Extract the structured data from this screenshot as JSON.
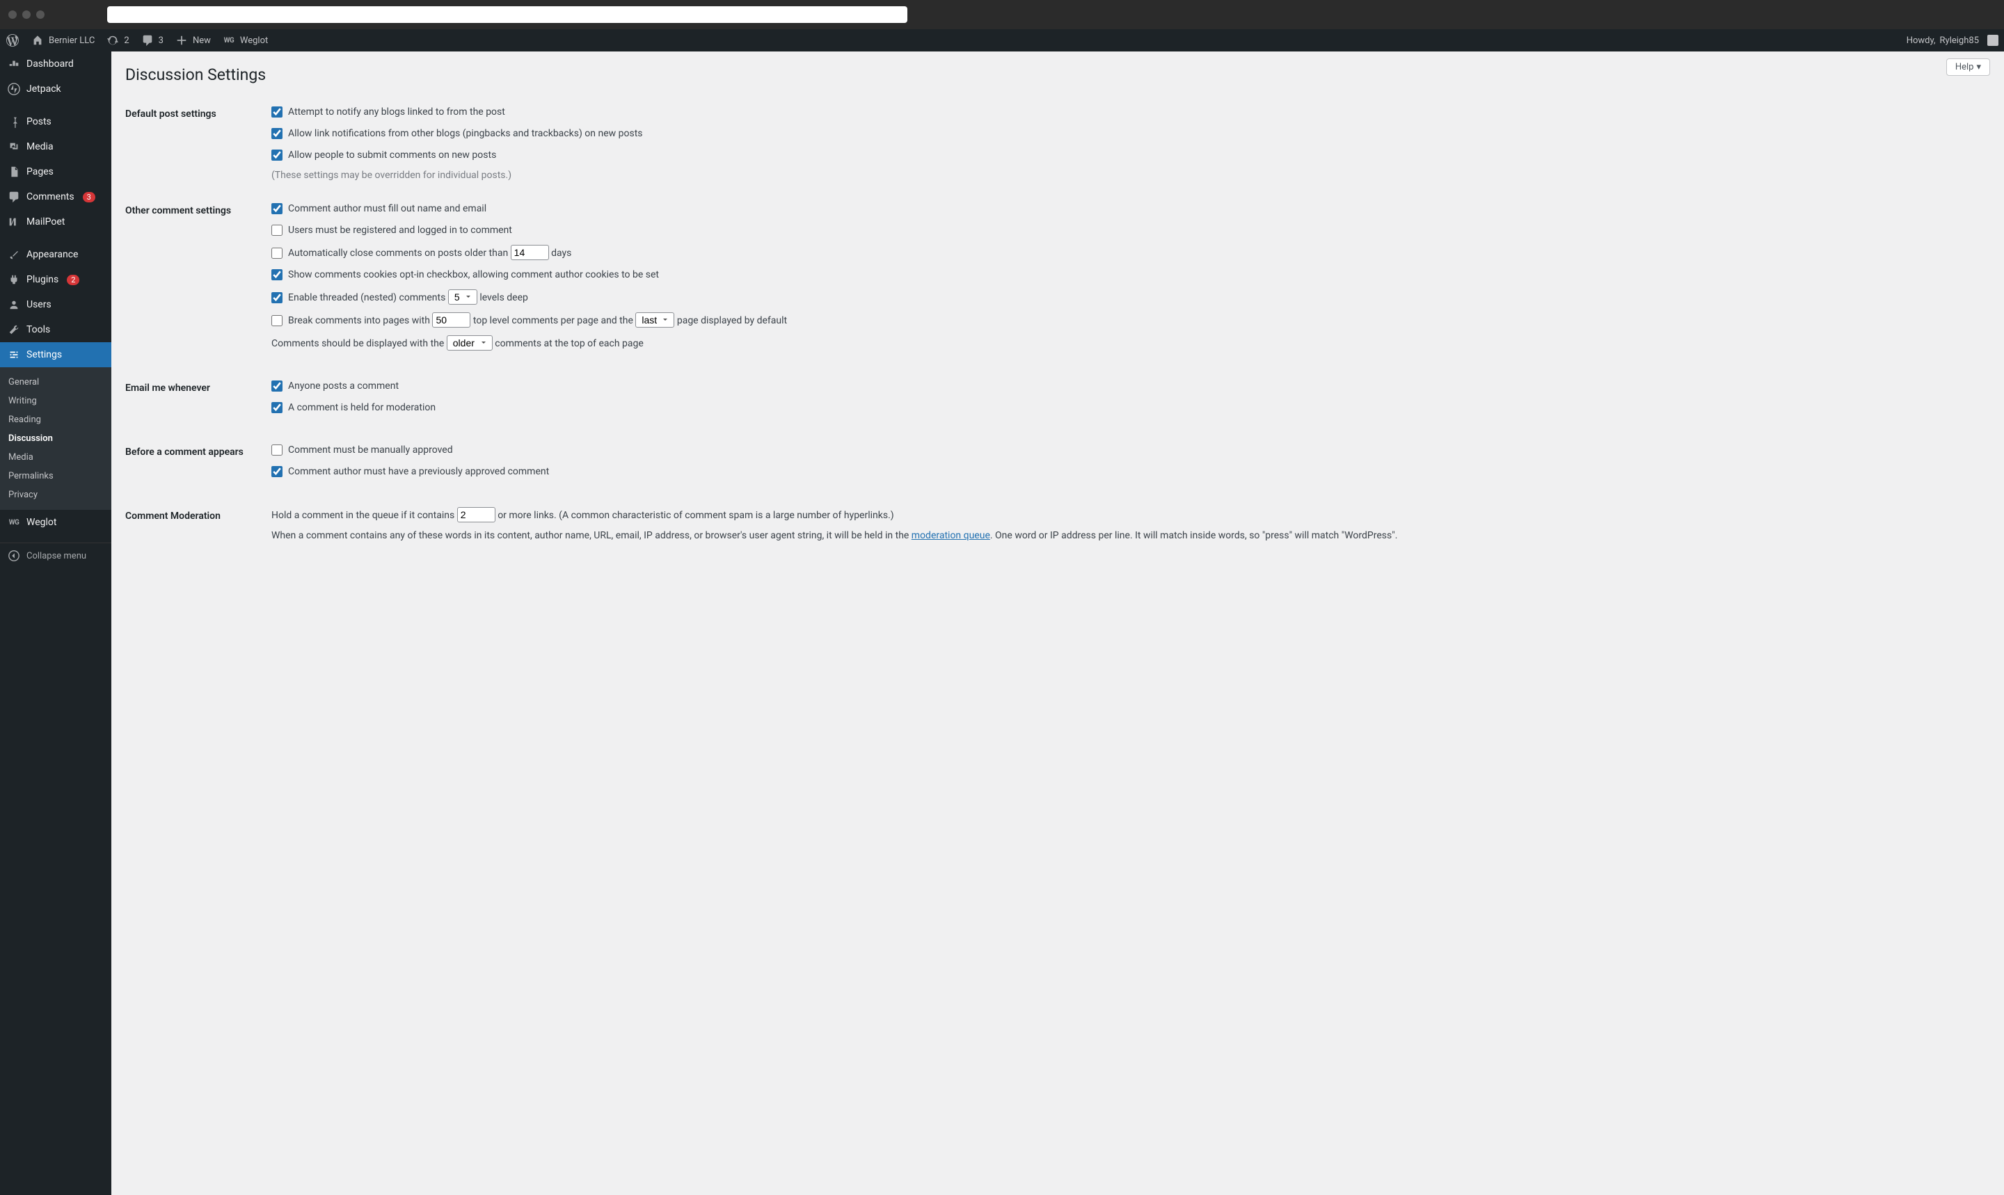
{
  "admin_bar": {
    "site_name": "Bernier LLC",
    "updates_count": "2",
    "comments_count": "3",
    "new_label": "New",
    "weglot_label": "Weglot",
    "howdy_prefix": "Howdy, ",
    "user_name": "Ryleigh85"
  },
  "sidebar": {
    "dashboard": "Dashboard",
    "jetpack": "Jetpack",
    "posts": "Posts",
    "media": "Media",
    "pages": "Pages",
    "comments": "Comments",
    "comments_badge": "3",
    "mailpoet": "MailPoet",
    "appearance": "Appearance",
    "plugins": "Plugins",
    "plugins_badge": "2",
    "users": "Users",
    "tools": "Tools",
    "settings": "Settings",
    "weglot": "Weglot",
    "collapse": "Collapse menu",
    "submenu": {
      "general": "General",
      "writing": "Writing",
      "reading": "Reading",
      "discussion": "Discussion",
      "media": "Media",
      "permalinks": "Permalinks",
      "privacy": "Privacy"
    }
  },
  "content": {
    "help_label": "Help",
    "page_title": "Discussion Settings",
    "sections": {
      "default_post": "Default post settings",
      "other_comment": "Other comment settings",
      "email_me": "Email me whenever",
      "before_appears": "Before a comment appears",
      "moderation": "Comment Moderation"
    },
    "labels": {
      "attempt_notify": "Attempt to notify any blogs linked to from the post",
      "allow_pingback": "Allow link notifications from other blogs (pingbacks and trackbacks) on new posts",
      "allow_comments": "Allow people to submit comments on new posts",
      "override_note": "(These settings may be overridden for individual posts.)",
      "require_name_email": "Comment author must fill out name and email",
      "require_registration": "Users must be registered and logged in to comment",
      "close_old_pre": "Automatically close comments on posts older than ",
      "close_old_post": " days",
      "cookies_optin": "Show comments cookies opt-in checkbox, allowing comment author cookies to be set",
      "threaded_pre": "Enable threaded (nested) comments ",
      "threaded_post": " levels deep",
      "pagination_pre": "Break comments into pages with ",
      "pagination_mid": " top level comments per page and the ",
      "pagination_post": " page displayed by default",
      "order_pre": "Comments should be displayed with the ",
      "order_post": " comments at the top of each page",
      "anyone_posts": "Anyone posts a comment",
      "held_moderation": "A comment is held for moderation",
      "manual_approve": "Comment must be manually approved",
      "prev_approved": "Comment author must have a previously approved comment",
      "hold_pre": "Hold a comment in the queue if it contains ",
      "hold_post": " or more links. (A common characteristic of comment spam is a large number of hyperlinks.)",
      "moderation_text_pre": "When a comment contains any of these words in its content, author name, URL, email, IP address, or browser's user agent string, it will be held in the ",
      "moderation_link": "moderation queue",
      "moderation_text_post": ". One word or IP address per line. It will match inside words, so \"press\" will match \"WordPress\"."
    },
    "values": {
      "close_days": "14",
      "thread_levels": "5",
      "per_page": "50",
      "default_page": "last",
      "order": "older",
      "max_links": "2"
    }
  }
}
